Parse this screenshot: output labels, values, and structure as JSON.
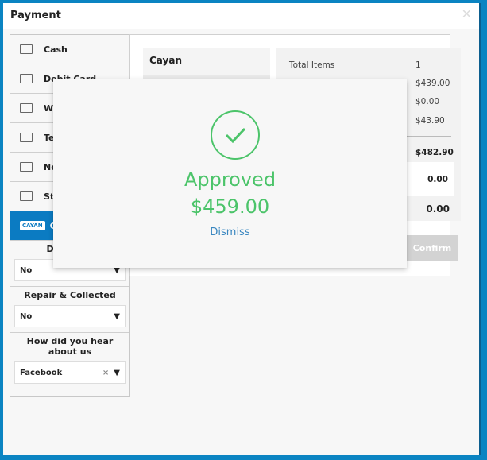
{
  "title": "Payment",
  "close_icon": "close-icon",
  "methods": [
    {
      "label": "Cash"
    },
    {
      "label": "Debit Card"
    },
    {
      "label": "Worl"
    },
    {
      "label": "Test"
    },
    {
      "label": "New"
    },
    {
      "label": "Strip"
    },
    {
      "label": "Cay",
      "logo": "CAYAN",
      "active": true
    }
  ],
  "fields": [
    {
      "label": "Disable N",
      "value": "No"
    },
    {
      "label": "Repair & Collected",
      "value": "No"
    },
    {
      "label": "How did you hear about us",
      "value": "Facebook",
      "clear": "×"
    }
  ],
  "card_title": "Cayan",
  "summary": {
    "total_items_label": "Total Items",
    "total_items": "1",
    "v1": "$439.00",
    "v2": "$0.00",
    "v3": "$43.90",
    "total": "$482.90",
    "paid": "0.00",
    "balance": "0.00"
  },
  "confirm_label": "Confirm",
  "modal": {
    "status": "Approved",
    "amount": "$459.00",
    "dismiss": "Dismiss",
    "color": "#4cc46a"
  }
}
